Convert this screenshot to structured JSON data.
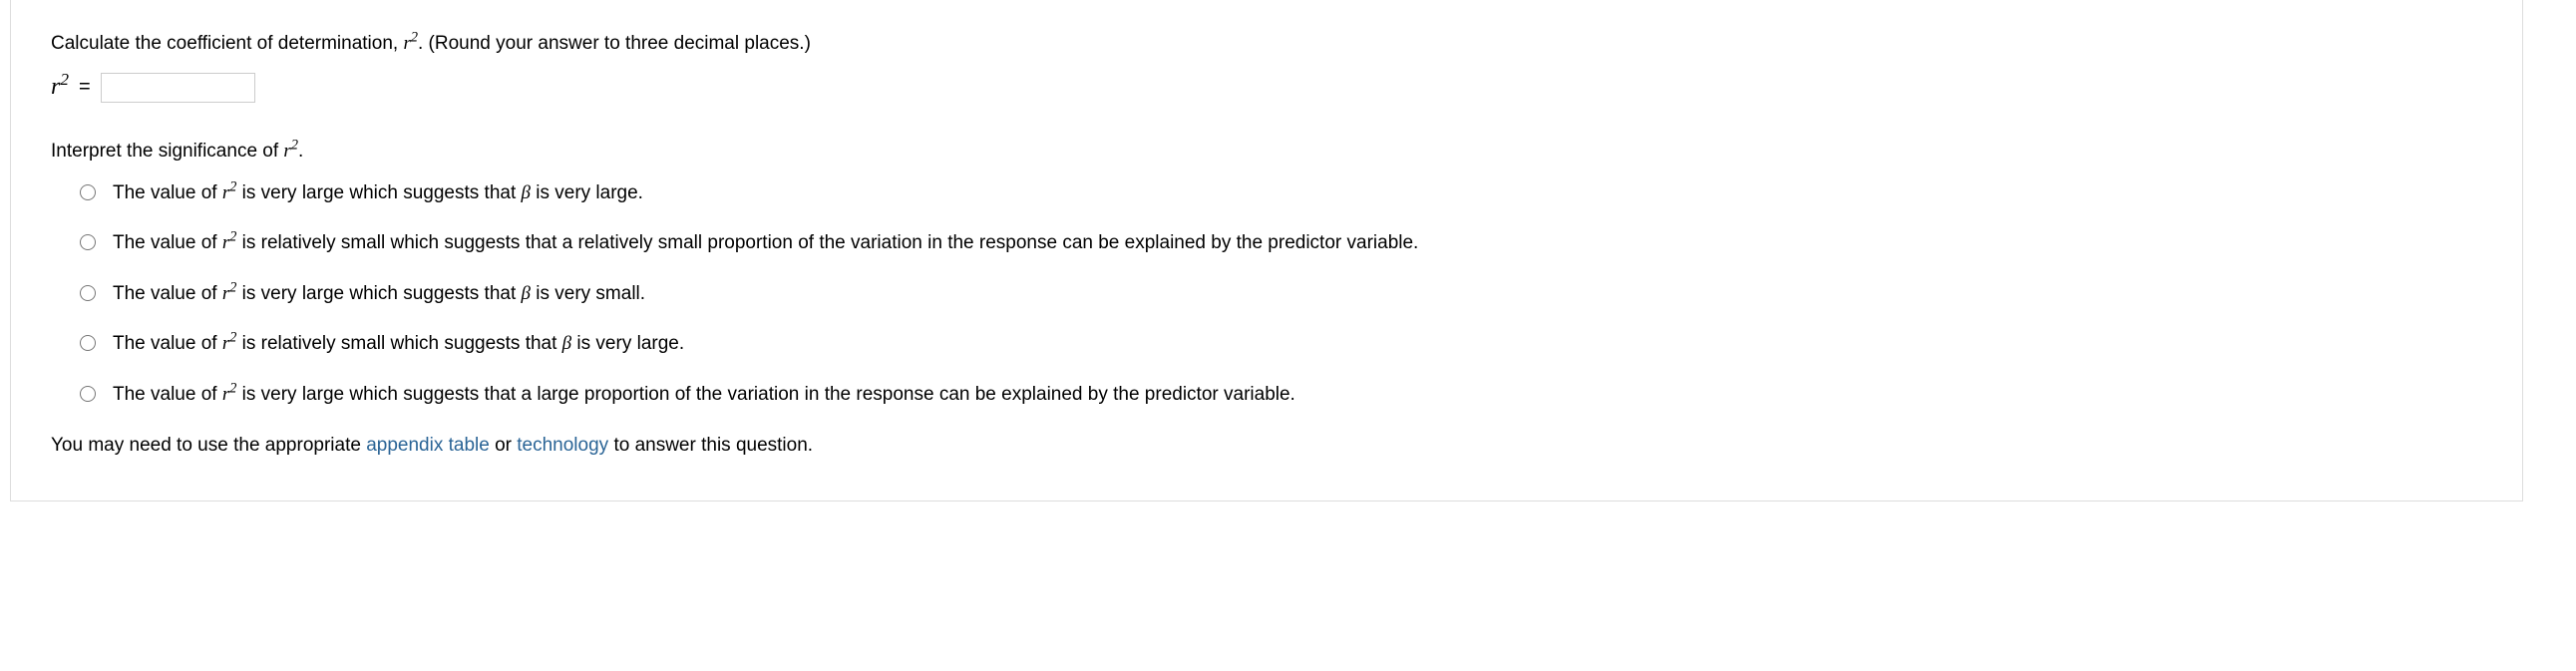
{
  "prompt": {
    "part1": "Calculate the coefficient of determination, ",
    "part2": ". (Round your answer to three decimal places.)"
  },
  "input_row": {
    "equals": "=",
    "value": ""
  },
  "sub_prompt": {
    "part1": "Interpret the significance of ",
    "part2": "."
  },
  "options": [
    {
      "p1": "The value of ",
      "p2": " is very large which suggests that ",
      "p3": " is very large.",
      "has_beta": true
    },
    {
      "p1": "The value of ",
      "p2": " is relatively small which suggests that a relatively small proportion of the variation in the response can be explained by the predictor variable.",
      "p3": "",
      "has_beta": false
    },
    {
      "p1": "The value of ",
      "p2": " is very large which suggests that ",
      "p3": " is very small.",
      "has_beta": true
    },
    {
      "p1": "The value of ",
      "p2": " is relatively small which suggests that ",
      "p3": " is very large.",
      "has_beta": true
    },
    {
      "p1": "The value of ",
      "p2": " is very large which suggests that a large proportion of the variation in the response can be explained by the predictor variable.",
      "p3": "",
      "has_beta": false
    }
  ],
  "hint": {
    "t1": "You may need to use the appropriate ",
    "link1": "appendix table",
    "t2": " or ",
    "link2": "technology",
    "t3": " to answer this question."
  }
}
